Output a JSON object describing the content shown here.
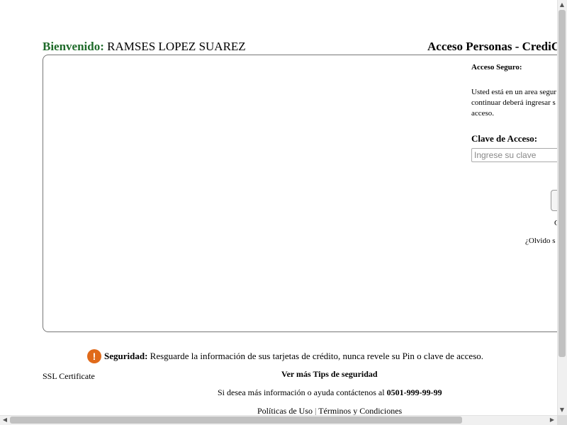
{
  "header": {
    "welcome_label": "Bienvenido:",
    "user_name": "RAMSES LOPEZ SUAREZ",
    "access_title": "Acceso Personas - CrediCa"
  },
  "login": {
    "secure_heading": "Acceso Seguro:",
    "secure_text": "Usted está en un area segur continuar deberá ingresar s acceso.",
    "password_label": "Clave de Acceso:",
    "password_placeholder": "Ingrese su clave",
    "fragment_c": "C",
    "forgot_link": "¿Olvido s"
  },
  "footer": {
    "security_label": "Seguridad:",
    "security_text": "Resguarde la información de sus tarjetas de crédito, nunca revele su Pin o clave de acceso.",
    "ssl_text": "SSL Certificate",
    "tips_link": "Ver más Tips de seguridad",
    "contact_text": "Si desea más información o ayuda contáctenos al",
    "contact_phone": "0501-999-99-99",
    "policies_link": "Políticas de Uso",
    "separator": "|",
    "terms_link": "Términos y Condiciones"
  },
  "colors": {
    "welcome_green": "#1f6b2a",
    "warning_orange": "#e06a1a"
  },
  "icons": {
    "warning": "warning-icon"
  }
}
